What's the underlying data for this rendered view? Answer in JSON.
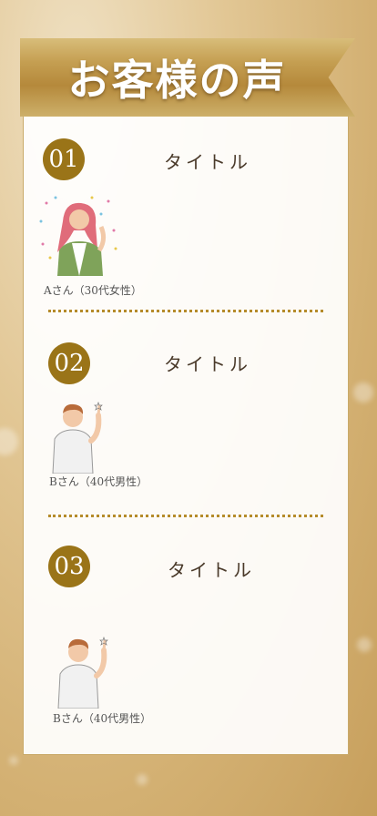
{
  "banner": {
    "title": "お客様の声"
  },
  "items": [
    {
      "number": "01",
      "title": "タイトル",
      "caption": "Aさん（30代女性）"
    },
    {
      "number": "02",
      "title": "タイトル",
      "caption": "Bさん（40代男性）"
    },
    {
      "number": "03",
      "title": "タイトル",
      "caption": "Bさん（40代男性）"
    }
  ],
  "colors": {
    "gold": "#9a7418",
    "banner": "#c59f52",
    "dots": "#b58b2a"
  }
}
